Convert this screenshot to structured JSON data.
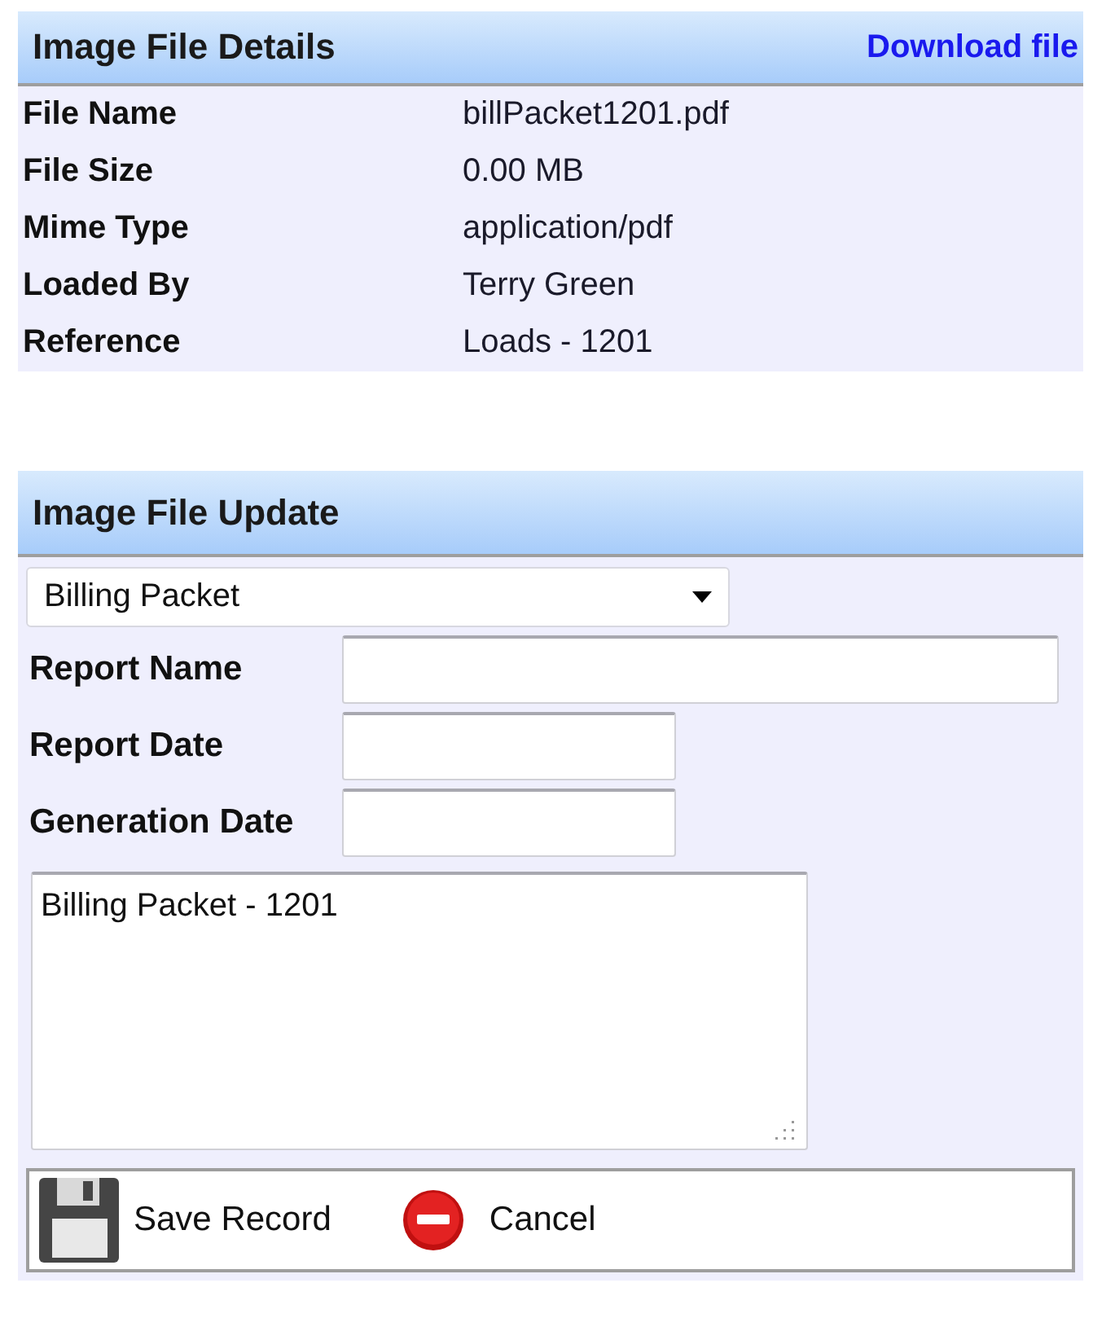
{
  "details": {
    "title": "Image File Details",
    "link": "Download file",
    "rows": [
      {
        "label": "File Name",
        "value": "billPacket1201.pdf"
      },
      {
        "label": "File Size",
        "value": "0.00 MB"
      },
      {
        "label": "Mime Type",
        "value": "application/pdf"
      },
      {
        "label": "Loaded By",
        "value": "Terry Green"
      },
      {
        "label": "Reference",
        "value": "Loads - 1201"
      }
    ]
  },
  "update": {
    "title": "Image File Update",
    "report_type": {
      "value": "Billing Packet"
    },
    "fields": [
      {
        "label": "Report Name",
        "kind": "text"
      },
      {
        "label": "Report Date",
        "kind": "date"
      },
      {
        "label": "Generation Date",
        "kind": "date"
      }
    ],
    "notes": {
      "value": "Billing Packet - 1201"
    },
    "buttons": [
      {
        "label": "Save Record",
        "kind": "save"
      },
      {
        "label": "Cancel",
        "kind": "cancel"
      }
    ]
  }
}
